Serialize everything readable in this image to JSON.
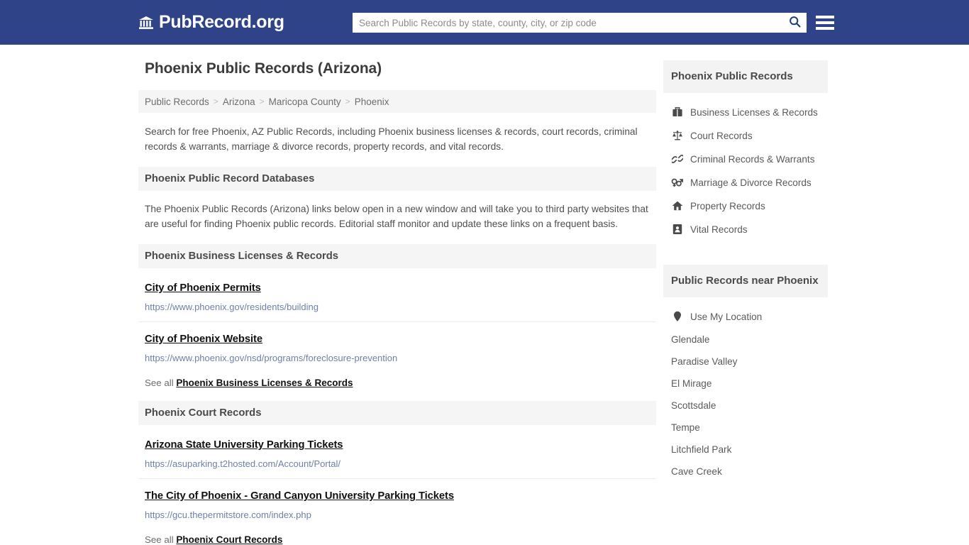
{
  "header": {
    "brand_text": "PubRecord.org",
    "brand_icon": "bank-building-icon",
    "search_placeholder": "Search Public Records by state, county, city, or zip code",
    "search_value": "",
    "search_icon": "search-icon",
    "menu_icon": "hamburger-menu-icon",
    "background_color": "#2e4388"
  },
  "main": {
    "title": "Phoenix Public Records (Arizona)",
    "breadcrumb": [
      "Public Records",
      "Arizona",
      "Maricopa County",
      "Phoenix"
    ],
    "breadcrumb_separator": ">",
    "intro": "Search for free Phoenix, AZ Public Records, including Phoenix business licenses & records, court records, criminal records & warrants, marriage & divorce records, property records, and vital records.",
    "databases_heading": "Phoenix Public Record Databases",
    "databases_body": "The Phoenix Public Records (Arizona) links below open in a new window and will take you to third party websites that are useful for finding Phoenix public records. Editorial staff monitor and update these links on a frequent basis.",
    "sections": [
      {
        "heading": "Phoenix Business Licenses & Records",
        "links": [
          {
            "title": "City of Phoenix Permits",
            "url": "https://www.phoenix.gov/residents/building"
          },
          {
            "title": "City of Phoenix Website",
            "url": "https://www.phoenix.gov/nsd/programs/foreclosure-prevention"
          }
        ],
        "see_all_prefix": "See all",
        "see_all_label": "Phoenix Business Licenses & Records"
      },
      {
        "heading": "Phoenix Court Records",
        "links": [
          {
            "title": "Arizona State University Parking Tickets",
            "url": "https://asuparking.t2hosted.com/Account/Portal/"
          },
          {
            "title": "The City of Phoenix - Grand Canyon University Parking Tickets",
            "url": "https://gcu.thepermitstore.com/index.php"
          }
        ],
        "see_all_prefix": "See all",
        "see_all_label": "Phoenix Court Records"
      }
    ]
  },
  "sidebar": {
    "records_heading": "Phoenix Public Records",
    "records_items": [
      {
        "label": "Business Licenses & Records",
        "icon": "briefcase-icon"
      },
      {
        "label": "Court Records",
        "icon": "balance-scale-icon"
      },
      {
        "label": "Criminal Records & Warrants",
        "icon": "chain-link-icon"
      },
      {
        "label": "Marriage & Divorce Records",
        "icon": "venus-mars-icon"
      },
      {
        "label": "Property Records",
        "icon": "home-icon"
      },
      {
        "label": "Vital Records",
        "icon": "id-card-icon"
      }
    ],
    "near_heading": "Public Records near Phoenix",
    "use_my_location": "Use My Location",
    "location_icon": "map-pin-icon",
    "nearby_cities": [
      "Glendale",
      "Paradise Valley",
      "El Mirage",
      "Scottsdale",
      "Tempe",
      "Litchfield Park",
      "Cave Creek"
    ]
  }
}
